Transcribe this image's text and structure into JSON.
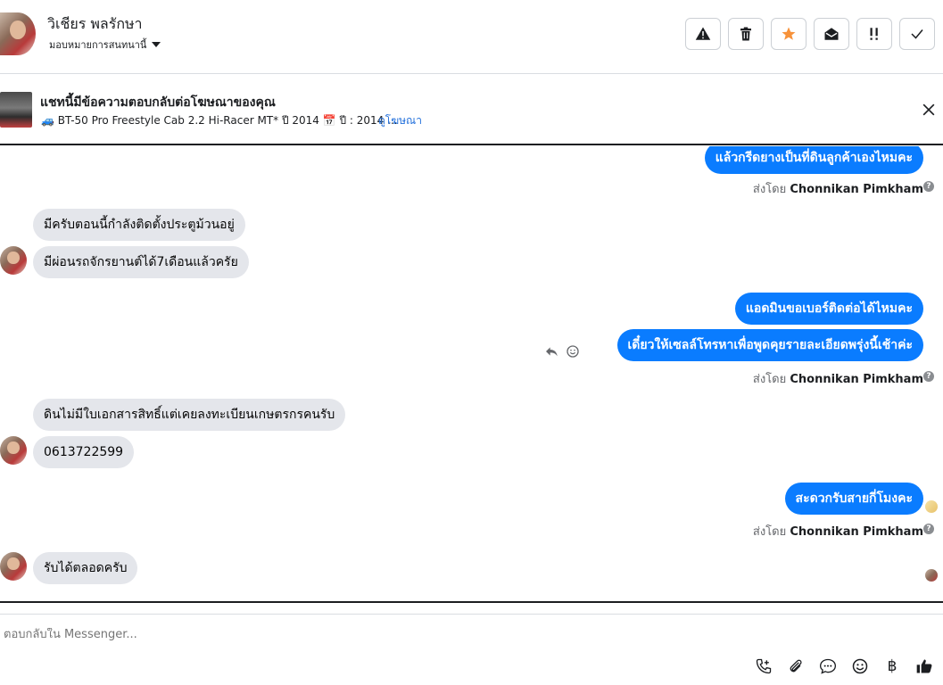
{
  "header": {
    "contact_name": "วิเชียร พลรักษา",
    "assign_label": "มอบหมายการสนทนานี้",
    "actions": [
      {
        "name": "report-spam-button",
        "icon": "warning-icon",
        "glyph": "⚠"
      },
      {
        "name": "delete-button",
        "icon": "trash-icon",
        "glyph": "🗑"
      },
      {
        "name": "star-button",
        "icon": "star-icon",
        "glyph": "★"
      },
      {
        "name": "mark-unread-button",
        "icon": "envelope-open-icon",
        "glyph": "✉"
      },
      {
        "name": "mark-follow-up-button",
        "icon": "exclamation-icon",
        "glyph": "!!"
      },
      {
        "name": "mark-done-button",
        "icon": "check-icon",
        "glyph": "✓"
      }
    ]
  },
  "ad_banner": {
    "title": "แชทนี้มีข้อความตอบกลับต่อโฆษณาของคุณ",
    "subtitle": "🚙 BT-50 Pro Freestyle Cab 2.2 Hi-Racer MT* ปี 2014 📅 ปี : 2014 ...",
    "link": "ดูโฆษณา"
  },
  "messages": {
    "m1": "แล้วกรีดยางเป็นที่ดินลูกค้าเองไหมคะ",
    "m2": "มีครับตอนนี้กำลังติดตั้งประตูม้วนอยู่",
    "m3": "มีผ่อนรถจักรยานต์ได้7เดือนแล้วครัย",
    "m4": "แอดมินขอเบอร์ติดต่อได้ไหมคะ",
    "m5": "เดี๋ยวให้เซลล์โทรหาเพื่อพูดคุยรายละเอียดพรุ่งนี้เช้าค่ะ",
    "m6": "ดินไม่มีใบเอกสารสิทธิ์แต่เคยลงทะเบียนเกษตรกรคนรับ",
    "m7": "0613722599",
    "m8": "สะดวกรับสายกี่โมงคะ",
    "m9": "รับได้ตลอดครับ"
  },
  "sent_by": {
    "prefix": "ส่งโดย",
    "agent": "Chonnikan Pimkham"
  },
  "composer": {
    "placeholder": "ตอบกลับใน Messenger..."
  },
  "tools": [
    {
      "name": "call-icon",
      "glyph": "📞"
    },
    {
      "name": "attachment-icon",
      "glyph": "📎"
    },
    {
      "name": "saved-reply-icon",
      "glyph": "💬"
    },
    {
      "name": "emoji-icon",
      "glyph": "☺"
    },
    {
      "name": "payment-icon",
      "glyph": "฿"
    },
    {
      "name": "like-icon",
      "glyph": "👍"
    }
  ]
}
